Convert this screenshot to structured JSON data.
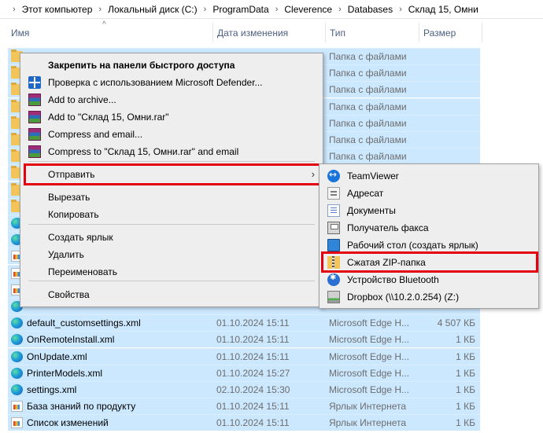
{
  "breadcrumb": [
    "Этот компьютер",
    "Локальный диск (C:)",
    "ProgramData",
    "Cleverence",
    "Databases",
    "Склад 15, Омни"
  ],
  "breadcrumb_separator": "›",
  "columns": {
    "name": "Имя",
    "date": "Дата изменения",
    "type": "Тип",
    "size": "Размер"
  },
  "sort_caret": "^",
  "files": [
    {
      "name": "",
      "date": "",
      "type": "Папка с файлами",
      "size": "",
      "icon": "folder-icon"
    },
    {
      "name": "",
      "date": "",
      "type": "Папка с файлами",
      "size": "",
      "icon": "folder-icon"
    },
    {
      "name": "",
      "date": "",
      "type": "Папка с файлами",
      "size": "",
      "icon": "folder-icon"
    },
    {
      "name": "",
      "date": "",
      "type": "Папка с файлами",
      "size": "",
      "icon": "folder-icon"
    },
    {
      "name": "",
      "date": "",
      "type": "Папка с файлами",
      "size": "",
      "icon": "folder-icon"
    },
    {
      "name": "",
      "date": "",
      "type": "Папка с файлами",
      "size": "",
      "icon": "folder-icon"
    },
    {
      "name": "",
      "date": "",
      "type": "Папка с файлами",
      "size": "",
      "icon": "folder-icon"
    },
    {
      "name": "",
      "date": "",
      "type": "",
      "size": "",
      "icon": "folder-icon"
    },
    {
      "name": "",
      "date": "",
      "type": "",
      "size": "",
      "icon": "folder-icon"
    },
    {
      "name": "",
      "date": "",
      "type": "",
      "size": "",
      "icon": "folder-icon"
    },
    {
      "name": "",
      "date": "",
      "type": "",
      "size": "",
      "icon": "edge-icon"
    },
    {
      "name": "",
      "date": "",
      "type": "",
      "size": "",
      "icon": "edge-icon"
    },
    {
      "name": "",
      "date": "",
      "type": "",
      "size": "",
      "icon": "link-icon"
    },
    {
      "name": "",
      "date": "",
      "type": "",
      "size": "",
      "icon": "link-icon"
    },
    {
      "name": "",
      "date": "",
      "type": "",
      "size": "",
      "icon": "link-icon"
    },
    {
      "name": "",
      "date": "",
      "type": "",
      "size": "",
      "icon": "edge-icon"
    },
    {
      "name": "default_customsettings.xml",
      "date": "01.10.2024 15:11",
      "type": "Microsoft Edge H...",
      "size": "4 507 КБ",
      "icon": "edge-icon"
    },
    {
      "name": "OnRemoteInstall.xml",
      "date": "01.10.2024 15:11",
      "type": "Microsoft Edge H...",
      "size": "1 КБ",
      "icon": "edge-icon"
    },
    {
      "name": "OnUpdate.xml",
      "date": "01.10.2024 15:11",
      "type": "Microsoft Edge H...",
      "size": "1 КБ",
      "icon": "edge-icon"
    },
    {
      "name": "PrinterModels.xml",
      "date": "01.10.2024 15:27",
      "type": "Microsoft Edge H...",
      "size": "1 КБ",
      "icon": "edge-icon"
    },
    {
      "name": "settings.xml",
      "date": "02.10.2024 15:30",
      "type": "Microsoft Edge H...",
      "size": "1 КБ",
      "icon": "edge-icon"
    },
    {
      "name": "База знаний по продукту",
      "date": "01.10.2024 15:11",
      "type": "Ярлык Интернета",
      "size": "1 КБ",
      "icon": "link-icon"
    },
    {
      "name": "Список изменений",
      "date": "01.10.2024 15:11",
      "type": "Ярлык Интернета",
      "size": "1 КБ",
      "icon": "link-icon"
    }
  ],
  "context_menu": {
    "items": [
      {
        "label": "Закрепить на панели быстрого доступа",
        "bold": true,
        "icon": ""
      },
      {
        "label": "Проверка с использованием Microsoft Defender...",
        "icon": "defender-shield-icon"
      },
      {
        "label": "Add to archive...",
        "icon": "winrar-icon"
      },
      {
        "label": "Add to \"Склад 15, Омни.rar\"",
        "icon": "winrar-icon"
      },
      {
        "label": "Compress and email...",
        "icon": "winrar-icon"
      },
      {
        "label": "Compress to \"Склад 15, Омни.rar\" and email",
        "icon": "winrar-icon"
      },
      {
        "label": "Отправить",
        "icon": "",
        "submenu": true,
        "highlighted": true
      },
      {
        "label": "Вырезать",
        "icon": ""
      },
      {
        "label": "Копировать",
        "icon": ""
      },
      {
        "label": "Создать ярлык",
        "icon": ""
      },
      {
        "label": "Удалить",
        "icon": ""
      },
      {
        "label": "Переименовать",
        "icon": ""
      },
      {
        "label": "Свойства",
        "icon": ""
      }
    ],
    "submenu_arrow": "›"
  },
  "send_to_menu": {
    "items": [
      {
        "label": "TeamViewer",
        "icon": "teamviewer-icon"
      },
      {
        "label": "Адресат",
        "icon": "contacts-icon"
      },
      {
        "label": "Документы",
        "icon": "documents-icon"
      },
      {
        "label": "Получатель факса",
        "icon": "fax-icon"
      },
      {
        "label": "Рабочий стол (создать ярлык)",
        "icon": "desktop-icon"
      },
      {
        "label": "Сжатая ZIP-папка",
        "icon": "zip-folder-icon",
        "highlighted": true
      },
      {
        "label": "Устройство Bluetooth",
        "icon": "bluetooth-icon"
      },
      {
        "label": "Dropbox (\\\\10.2.0.254) (Z:)",
        "icon": "network-drive-icon"
      }
    ]
  },
  "colors": {
    "selection": "#cce8ff",
    "menu_bg": "#eeeeee",
    "highlight_border": "#e3000f",
    "header_text": "#4d6082",
    "folder": "#f2c45a"
  }
}
